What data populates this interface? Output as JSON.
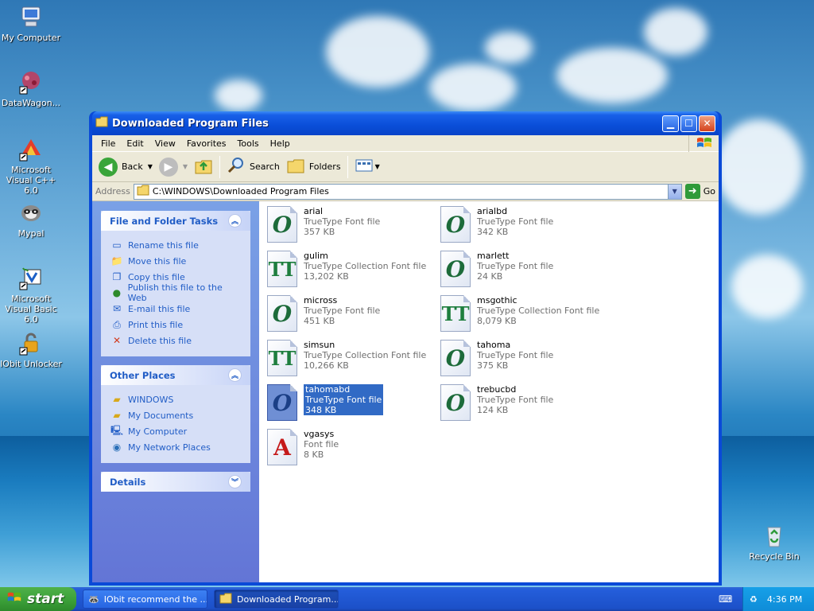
{
  "desktop": {
    "icons": [
      {
        "label": "My Computer"
      },
      {
        "label": "DataWagon..."
      },
      {
        "label": "Microsoft Visual C++ 6.0"
      },
      {
        "label": "Mypal"
      },
      {
        "label": "Microsoft Visual Basic 6.0"
      },
      {
        "label": "IObit Unlocker"
      },
      {
        "label": "Recycle Bin"
      }
    ]
  },
  "window": {
    "title": "Downloaded Program Files",
    "menu": [
      "File",
      "Edit",
      "View",
      "Favorites",
      "Tools",
      "Help"
    ],
    "toolbar": {
      "back": "Back",
      "search": "Search",
      "folders": "Folders"
    },
    "address": {
      "label": "Address",
      "value": "C:\\WINDOWS\\Downloaded Program Files",
      "go": "Go"
    }
  },
  "tasks": {
    "file_folder": {
      "title": "File and Folder Tasks",
      "items": [
        "Rename this file",
        "Move this file",
        "Copy this file",
        "Publish this file to the Web",
        "E-mail this file",
        "Print this file",
        "Delete this file"
      ]
    },
    "other_places": {
      "title": "Other Places",
      "items": [
        "WINDOWS",
        "My Documents",
        "My Computer",
        "My Network Places"
      ]
    },
    "details": {
      "title": "Details"
    }
  },
  "files": [
    {
      "name": "arial",
      "type": "TrueType Font file",
      "size": "357 KB",
      "icon": "truetype-icon"
    },
    {
      "name": "arialbd",
      "type": "TrueType Font file",
      "size": "342 KB",
      "icon": "truetype-icon"
    },
    {
      "name": "gulim",
      "type": "TrueType Collection Font file",
      "size": "13,202 KB",
      "icon": "truetype-collection-icon"
    },
    {
      "name": "marlett",
      "type": "TrueType Font file",
      "size": "24 KB",
      "icon": "truetype-icon"
    },
    {
      "name": "micross",
      "type": "TrueType Font file",
      "size": "451 KB",
      "icon": "truetype-icon"
    },
    {
      "name": "msgothic",
      "type": "TrueType Collection Font file",
      "size": "8,079 KB",
      "icon": "truetype-collection-icon"
    },
    {
      "name": "simsun",
      "type": "TrueType Collection Font file",
      "size": "10,266 KB",
      "icon": "truetype-collection-icon"
    },
    {
      "name": "tahoma",
      "type": "TrueType Font file",
      "size": "375 KB",
      "icon": "truetype-icon"
    },
    {
      "name": "tahomabd",
      "type": "TrueType Font file",
      "size": "348 KB",
      "icon": "truetype-icon",
      "selected": true
    },
    {
      "name": "trebucbd",
      "type": "TrueType Font file",
      "size": "124 KB",
      "icon": "truetype-icon"
    },
    {
      "name": "vgasys",
      "type": "Font file",
      "size": "8 KB",
      "icon": "raster-font-icon"
    }
  ],
  "taskbar": {
    "start": "start",
    "items": [
      "IObit recommend the ...",
      "Downloaded Program..."
    ],
    "clock": "4:36 PM"
  }
}
